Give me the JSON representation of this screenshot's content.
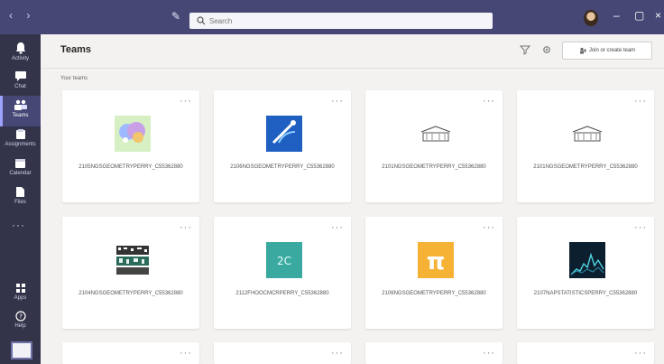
{
  "search": {
    "placeholder": "Search"
  },
  "header": {
    "title": "Teams",
    "join_label": "Join or create team",
    "section_label": "Your teams"
  },
  "rail": [
    {
      "label": "Activity",
      "icon": "bell-icon"
    },
    {
      "label": "Chat",
      "icon": "chat-icon"
    },
    {
      "label": "Teams",
      "icon": "teams-icon"
    },
    {
      "label": "Assignments",
      "icon": "assignments-icon"
    },
    {
      "label": "Calendar",
      "icon": "calendar-icon"
    },
    {
      "label": "Files",
      "icon": "files-icon"
    },
    {
      "label": "Apps",
      "icon": "apps-icon"
    },
    {
      "label": "Help",
      "icon": "help-icon"
    }
  ],
  "teams": [
    {
      "name": "2105NGSGEOMETRYPERRY_C55362880"
    },
    {
      "name": "2106NGSGEOMETRYPERRY_C55362880"
    },
    {
      "name": "2101NGSGEOMETRYPERRY_C55362880"
    },
    {
      "name": "2101NGSGEOMETRYPERRY_C55362880"
    },
    {
      "name": "2104NGSGEOMETRYPERRY_C55362880"
    },
    {
      "name": "2112FHOOCMCRPERRY_C55362880"
    },
    {
      "name": "2106NGSGEOMETRYPERRY_C55362880"
    },
    {
      "name": "2107NAPSTATISTICSPERRY_C55362880"
    }
  ],
  "tile_initials": "2C",
  "pi_symbol": "π",
  "colors": {
    "topbar": "#464775",
    "rail": "#33344a",
    "accent": "#6264a7"
  }
}
